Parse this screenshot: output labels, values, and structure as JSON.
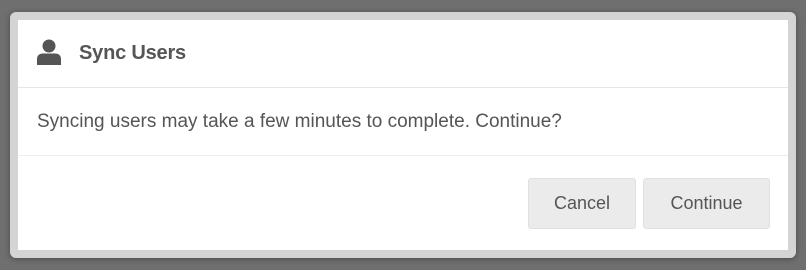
{
  "dialog": {
    "title": "Sync Users",
    "header_icon": "user-icon",
    "message": "Syncing users may take a few minutes to complete. Continue?",
    "buttons": {
      "cancel_label": "Cancel",
      "continue_label": "Continue"
    }
  },
  "colors": {
    "backdrop": "#6f6f6f",
    "dialog_border": "#d4d4d4",
    "text": "#555555",
    "button_bg": "#ebebeb"
  }
}
